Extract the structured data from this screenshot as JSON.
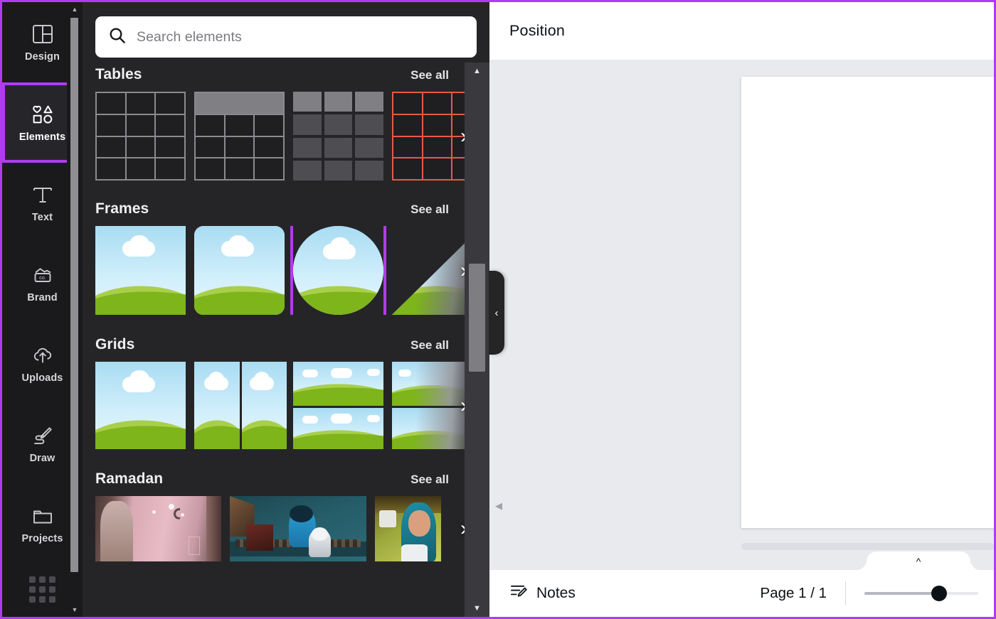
{
  "theme": {
    "highlight_purple": "#b13bef",
    "panel_bg": "#252528",
    "rail_bg": "#1a1a1d",
    "canvas_bg": "#e9eaee",
    "accent_red": "#e8594a"
  },
  "rail": {
    "items": [
      {
        "label": "Design",
        "icon": "layout-icon",
        "active": false,
        "highlighted": false
      },
      {
        "label": "Elements",
        "icon": "shapes-icon",
        "active": true,
        "highlighted": true
      },
      {
        "label": "Text",
        "icon": "text-t-icon",
        "active": false,
        "highlighted": false
      },
      {
        "label": "Brand",
        "icon": "brand-co-icon",
        "active": false,
        "highlighted": false
      },
      {
        "label": "Uploads",
        "icon": "upload-cloud-icon",
        "active": false,
        "highlighted": false
      },
      {
        "label": "Draw",
        "icon": "pen-draw-icon",
        "active": false,
        "highlighted": false
      },
      {
        "label": "Projects",
        "icon": "folder-icon",
        "active": false,
        "highlighted": false
      }
    ],
    "apps_icon": "apps-grid-icon"
  },
  "search": {
    "placeholder": "Search elements",
    "icon": "search-icon",
    "value": ""
  },
  "sections": [
    {
      "title": "Tables",
      "see_all": "See all",
      "next_icon": "chevron-right-icon",
      "items": [
        "table-plain",
        "table-header-gray",
        "table-cells-gray",
        "table-red-outline"
      ]
    },
    {
      "title": "Frames",
      "see_all": "See all",
      "next_icon": "chevron-right-icon",
      "items": [
        "frame-square",
        "frame-rounded",
        "frame-circle",
        "frame-triangle"
      ],
      "selected_index": 2
    },
    {
      "title": "Grids",
      "see_all": "See all",
      "next_icon": "chevron-right-icon",
      "items": [
        "grid-single",
        "grid-two-columns",
        "grid-two-rows",
        "grid-partial"
      ]
    },
    {
      "title": "Ramadan",
      "see_all": "See all",
      "next_icon": "chevron-right-icon",
      "items": [
        "photo-pink-prayer",
        "photo-teal-mosque",
        "photo-smiling-woman"
      ]
    }
  ],
  "panel": {
    "collapse_icon": "chevron-left-icon",
    "scroll_up_icon": "triangle-up-icon",
    "scroll_down_icon": "triangle-down-icon"
  },
  "topbar": {
    "title": "Position"
  },
  "bottombar": {
    "notes_label": "Notes",
    "notes_icon": "notes-pencil-icon",
    "page_indicator": "Page 1 / 1",
    "expand_icon": "chevron-up-icon",
    "zoom_slider_value": 62
  }
}
